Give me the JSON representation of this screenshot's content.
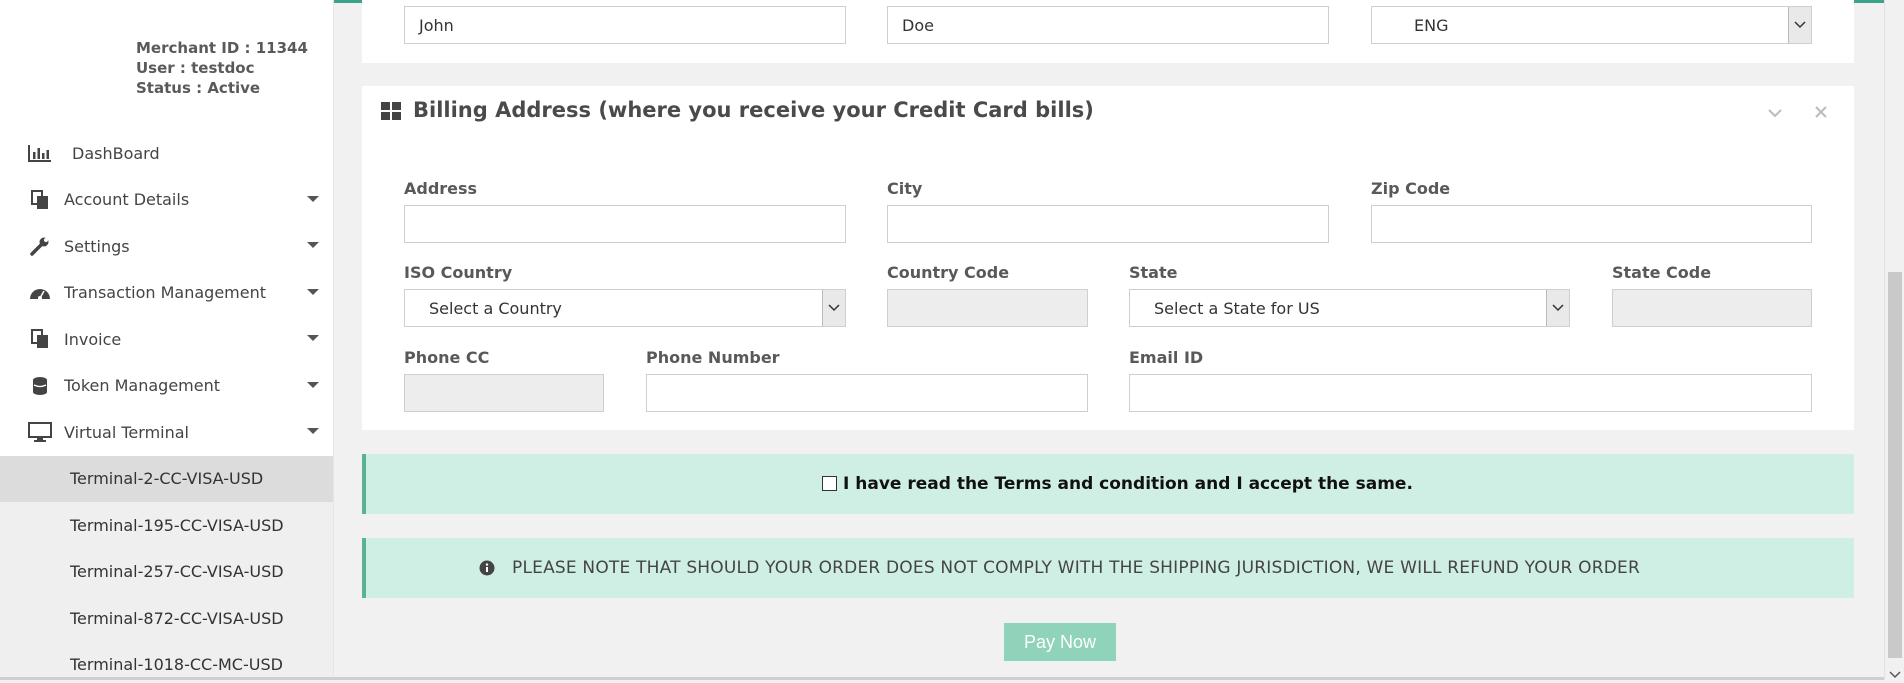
{
  "merchant": {
    "id_line": "Merchant ID : 11344",
    "user_line": "User : testdoc",
    "status_line": "Status : Active"
  },
  "sidebar": {
    "items": [
      {
        "label": "DashBoard",
        "icon": "bar-chart-icon"
      },
      {
        "label": "Account Details",
        "icon": "documents-icon"
      },
      {
        "label": "Settings",
        "icon": "wrench-icon"
      },
      {
        "label": "Transaction Management",
        "icon": "gauge-icon"
      },
      {
        "label": "Invoice",
        "icon": "documents-icon"
      },
      {
        "label": "Token Management",
        "icon": "database-icon"
      },
      {
        "label": "Virtual Terminal",
        "icon": "monitor-icon"
      }
    ],
    "terminals": [
      "Terminal-2-CC-VISA-USD",
      "Terminal-195-CC-VISA-USD",
      "Terminal-257-CC-VISA-USD",
      "Terminal-872-CC-VISA-USD",
      "Terminal-1018-CC-MC-USD"
    ]
  },
  "top_fields": {
    "first_name": "John",
    "last_name": "Doe",
    "language": "ENG"
  },
  "billing": {
    "title": "Billing Address (where you receive your Credit Card bills)",
    "address_label": "Address",
    "city_label": "City",
    "zip_label": "Zip Code",
    "iso_country_label": "ISO Country",
    "iso_country_value": "Select a Country",
    "country_code_label": "Country Code",
    "state_label": "State",
    "state_value": "Select a State for US",
    "state_code_label": "State Code",
    "phone_cc_label": "Phone CC",
    "phone_number_label": "Phone Number",
    "email_label": "Email ID"
  },
  "terms": "I have read the Terms and condition and I accept the same.",
  "notice": "PLEASE NOTE THAT SHOULD YOUR ORDER DOES NOT COMPLY WITH THE SHIPPING JURISDICTION, WE WILL REFUND YOUR ORDER",
  "pay_button": "Pay Now",
  "colors": {
    "accent": "#3aa38a",
    "notice_bg": "#d0efe4",
    "pay_button": "#8fd3bb"
  }
}
